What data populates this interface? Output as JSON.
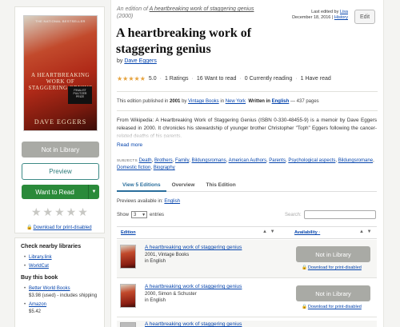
{
  "edition_header": {
    "prefix": "An edition of",
    "work_link": "A heartbreaking work of staggering genius",
    "year": "(2000)"
  },
  "last_edited": {
    "label": "Last edited by",
    "user": "Lisa",
    "date": "December 18, 2016",
    "sep": "|",
    "history": "History"
  },
  "edit_button": "Edit",
  "cover": {
    "top_text": "THE NATIONAL BESTSELLER",
    "title_text": "A HEARTBREAKING WORK OF STAGGERING GENIUS",
    "badge_text": "FINALIST PULITZER PRIZE",
    "author_text": "DAVE EGGERS"
  },
  "book": {
    "title": "A heartbreaking work of staggering genius",
    "by": "by",
    "author": "Dave Eggers"
  },
  "rating": {
    "stars": "★★★★★",
    "score": "5.0",
    "ratings": "1 Ratings",
    "want_to_read": "16 Want to read",
    "currently_reading": "0 Currently reading",
    "have_read": "1 Have read",
    "sep": "·"
  },
  "publication": {
    "prefix": "This edition published in",
    "year": "2001",
    "by": "by",
    "publisher": "Vintage Books",
    "in": "in",
    "place": "New York",
    "written_in": "Written in",
    "language": "English",
    "pages": "— 437 pages"
  },
  "description": "From Wikipedia: A Heartbreaking Work of Staggering Genius (ISBN 0-330-48455-9) is a memoir by Dave Eggers released in 2000. It chronicles his stewardship of younger brother Christopher \"Toph\" Eggers following the cancer-related deaths of his parents.",
  "read_more": "Read more",
  "subjects": {
    "heading": "Subjects",
    "items": [
      "Death",
      "Brothers",
      "Family",
      "Bildungsromans",
      "American Authors",
      "Parents",
      "Psychological aspects",
      "Bildungsromane",
      "Domestic fiction",
      "Biography"
    ]
  },
  "left_actions": {
    "not_in_library": "Not in Library",
    "preview": "Preview",
    "want_to_read": "Want to Read",
    "empty_stars": "★★★★★",
    "download": "Download for print-disabled"
  },
  "nearby": {
    "heading": "Check nearby libraries",
    "items": [
      "Library.link",
      "WorldCat"
    ]
  },
  "buy": {
    "heading": "Buy this book",
    "items": [
      {
        "name": "Better World Books",
        "price": "$3.98 (used) - includes shipping"
      },
      {
        "name": "Amazon",
        "price": "$5.42"
      }
    ]
  },
  "tabs": [
    "View 5 Editions",
    "Overview",
    "This Edition"
  ],
  "previews": {
    "label": "Previews available in:",
    "language": "English"
  },
  "table_controls": {
    "show": "Show",
    "entries_value": "3",
    "entries": "entries",
    "search_label": "Search:"
  },
  "table": {
    "col_edition": "Edition",
    "col_availability": "Availability",
    "col_availability_suffix": "·",
    "rows": [
      {
        "title": "A heartbreaking work of staggering genius",
        "meta1": "2001, Vintage Books",
        "meta2": "in English",
        "button": "Not in Library",
        "download": "Download for print-disabled"
      },
      {
        "title": "A heartbreaking work of staggering genius",
        "meta1": "2000, Simon & Schuster",
        "meta2": "in English",
        "button": "Not in Library",
        "download": "Download for print-disabled"
      },
      {
        "title": "A heartbreaking work of staggering genius"
      }
    ]
  },
  "sort_arrows": "▲ ▼",
  "colors": {
    "want_green": "#2a8a3a",
    "preview_teal": "#2a7a78",
    "link_blue": "#0645ad",
    "star_gold": "#e6a23c",
    "button_gray": "#a9aaa5"
  }
}
